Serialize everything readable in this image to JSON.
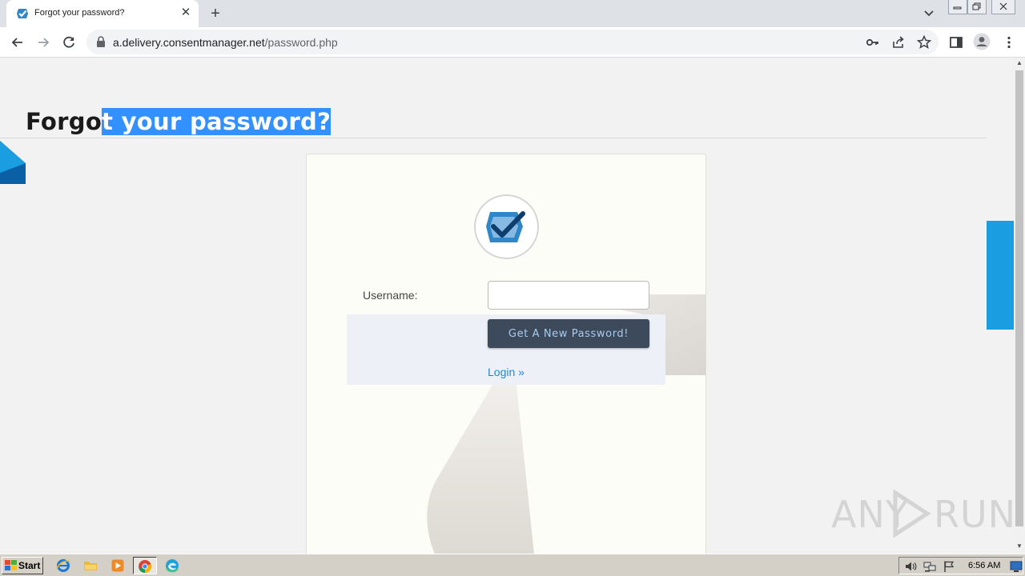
{
  "browser": {
    "tab": {
      "title": "Forgot your password?",
      "close_glyph": "✕",
      "favicon": "consentmanager-check-icon"
    },
    "new_tab_glyph": "+",
    "address": {
      "host": "a.delivery.consentmanager.net",
      "path": "/password.php"
    },
    "toolbar_icons": [
      "back-arrow-icon",
      "forward-arrow-icon",
      "reload-icon",
      "lock-icon",
      "key-icon",
      "share-icon",
      "star-icon",
      "side-panel-icon",
      "profile-icon",
      "more-menu-icon"
    ]
  },
  "page": {
    "title_unselected": "Forgo",
    "title_selected": "t your password?",
    "form": {
      "username_label": "Username:",
      "username_value": "",
      "submit_label": "Get A New Password!",
      "login_link": "Login »"
    },
    "colors": {
      "accent_blue": "#1b9de2",
      "button_bg": "#3d4a5c",
      "button_text": "#a9cbeb",
      "link": "#1b8bcf",
      "selection": "#3390ff"
    }
  },
  "watermark": {
    "left": "ANY",
    "right": "RUN"
  },
  "taskbar": {
    "start_label": "Start",
    "apps": [
      "internet-explorer-icon",
      "file-explorer-icon",
      "media-player-icon",
      "chrome-icon",
      "edge-icon"
    ],
    "active_app": "chrome-icon",
    "tray_icons": [
      "volume-icon",
      "network-icon",
      "flag-icon",
      "monitor-icon"
    ],
    "clock": "6:56 AM"
  }
}
